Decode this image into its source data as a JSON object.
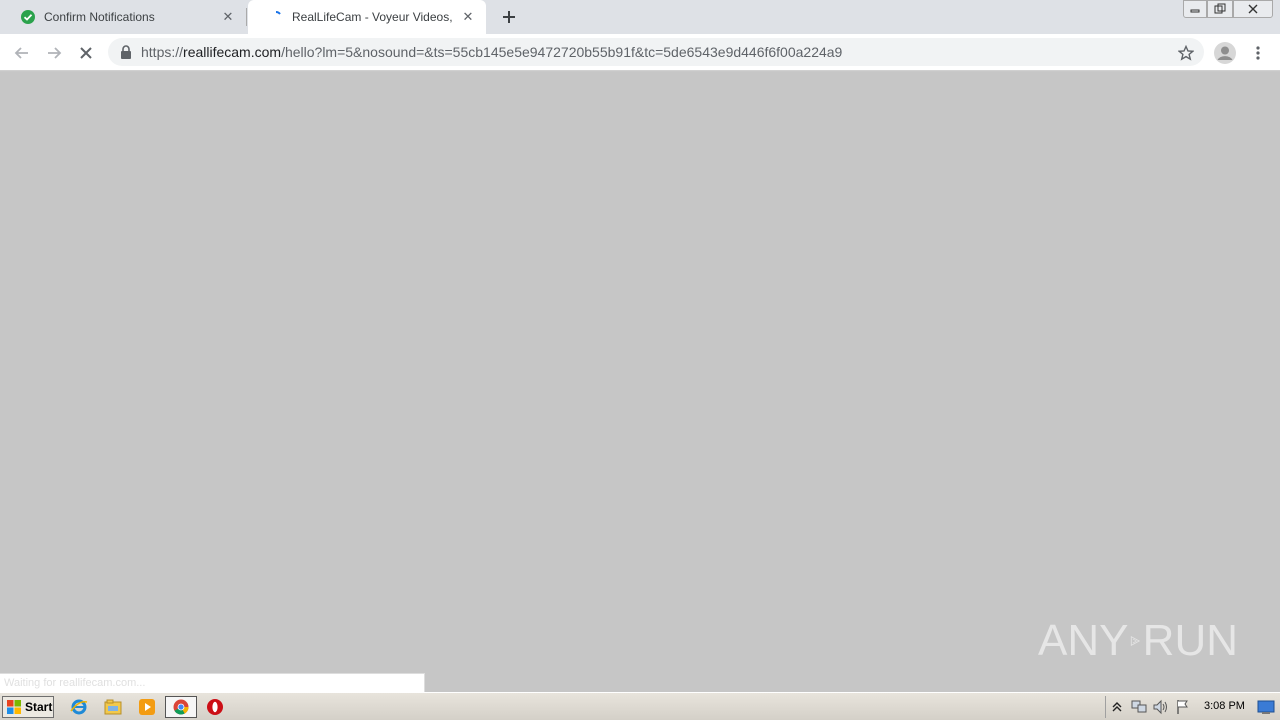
{
  "browser": {
    "tabs": [
      {
        "title": "Confirm Notifications",
        "icon": "check-circle-icon",
        "active": false
      },
      {
        "title": "RealLifeCam - Voyeur Videos, Hidden",
        "icon": "loading-spinner-icon",
        "active": true
      }
    ],
    "new_tab_icon": "plus-icon",
    "address": {
      "scheme": "https://",
      "host": "reallifecam.com",
      "path": "/hello?lm=5&nosound=&ts=55cb145e5e9472720b55b91f&tc=5de6543e9d446f6f00a224a9"
    },
    "status_text": "Waiting for reallifecam.com..."
  },
  "watermark": {
    "left": "ANY",
    "right": "RUN"
  },
  "taskbar": {
    "start_label": "Start",
    "clock": "3:08 PM"
  },
  "colors": {
    "content_bg": "#c6c6c6",
    "tabstrip_bg": "#dee1e6",
    "check_green": "#2ba24c",
    "opera_red": "#cc0f16"
  }
}
